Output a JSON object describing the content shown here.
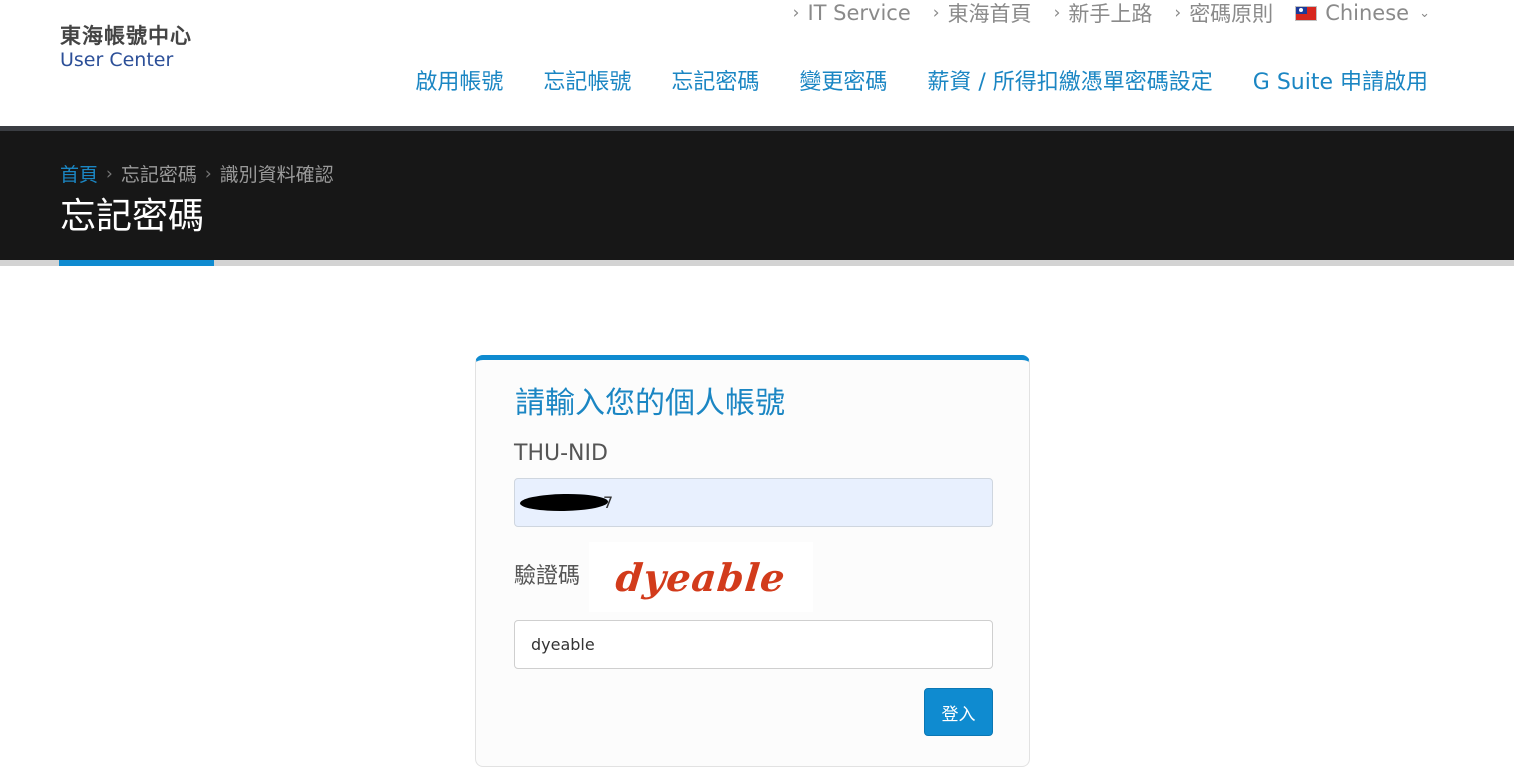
{
  "header": {
    "logo_title": "東海帳號中心",
    "logo_subtitle": "User Center",
    "top_links": [
      {
        "label": "IT Service"
      },
      {
        "label": "東海首頁"
      },
      {
        "label": "新手上路"
      },
      {
        "label": "密碼原則"
      }
    ],
    "language": {
      "label": "Chinese",
      "icon": "taiwan-flag-icon"
    },
    "nav": [
      {
        "label": "啟用帳號"
      },
      {
        "label": "忘記帳號"
      },
      {
        "label": "忘記密碼"
      },
      {
        "label": "變更密碼"
      },
      {
        "label": "薪資 / 所得扣繳憑單密碼設定"
      },
      {
        "label": "G Suite 申請啟用"
      }
    ]
  },
  "banner": {
    "breadcrumb": [
      "首頁",
      "忘記密碼",
      "識別資料確認"
    ],
    "title": "忘記密碼"
  },
  "form": {
    "title": "請輸入您的個人帳號",
    "nid_label": "THU-NID",
    "nid_value": "7",
    "captcha_label": "驗證碼",
    "captcha_image_text": "dyeable",
    "captcha_value": "dyeable",
    "submit_label": "登入"
  },
  "colors": {
    "accent": "#0f8bd0",
    "link": "#1b86c3",
    "banner_bg": "#171717",
    "captcha_text": "#d23b1b"
  }
}
